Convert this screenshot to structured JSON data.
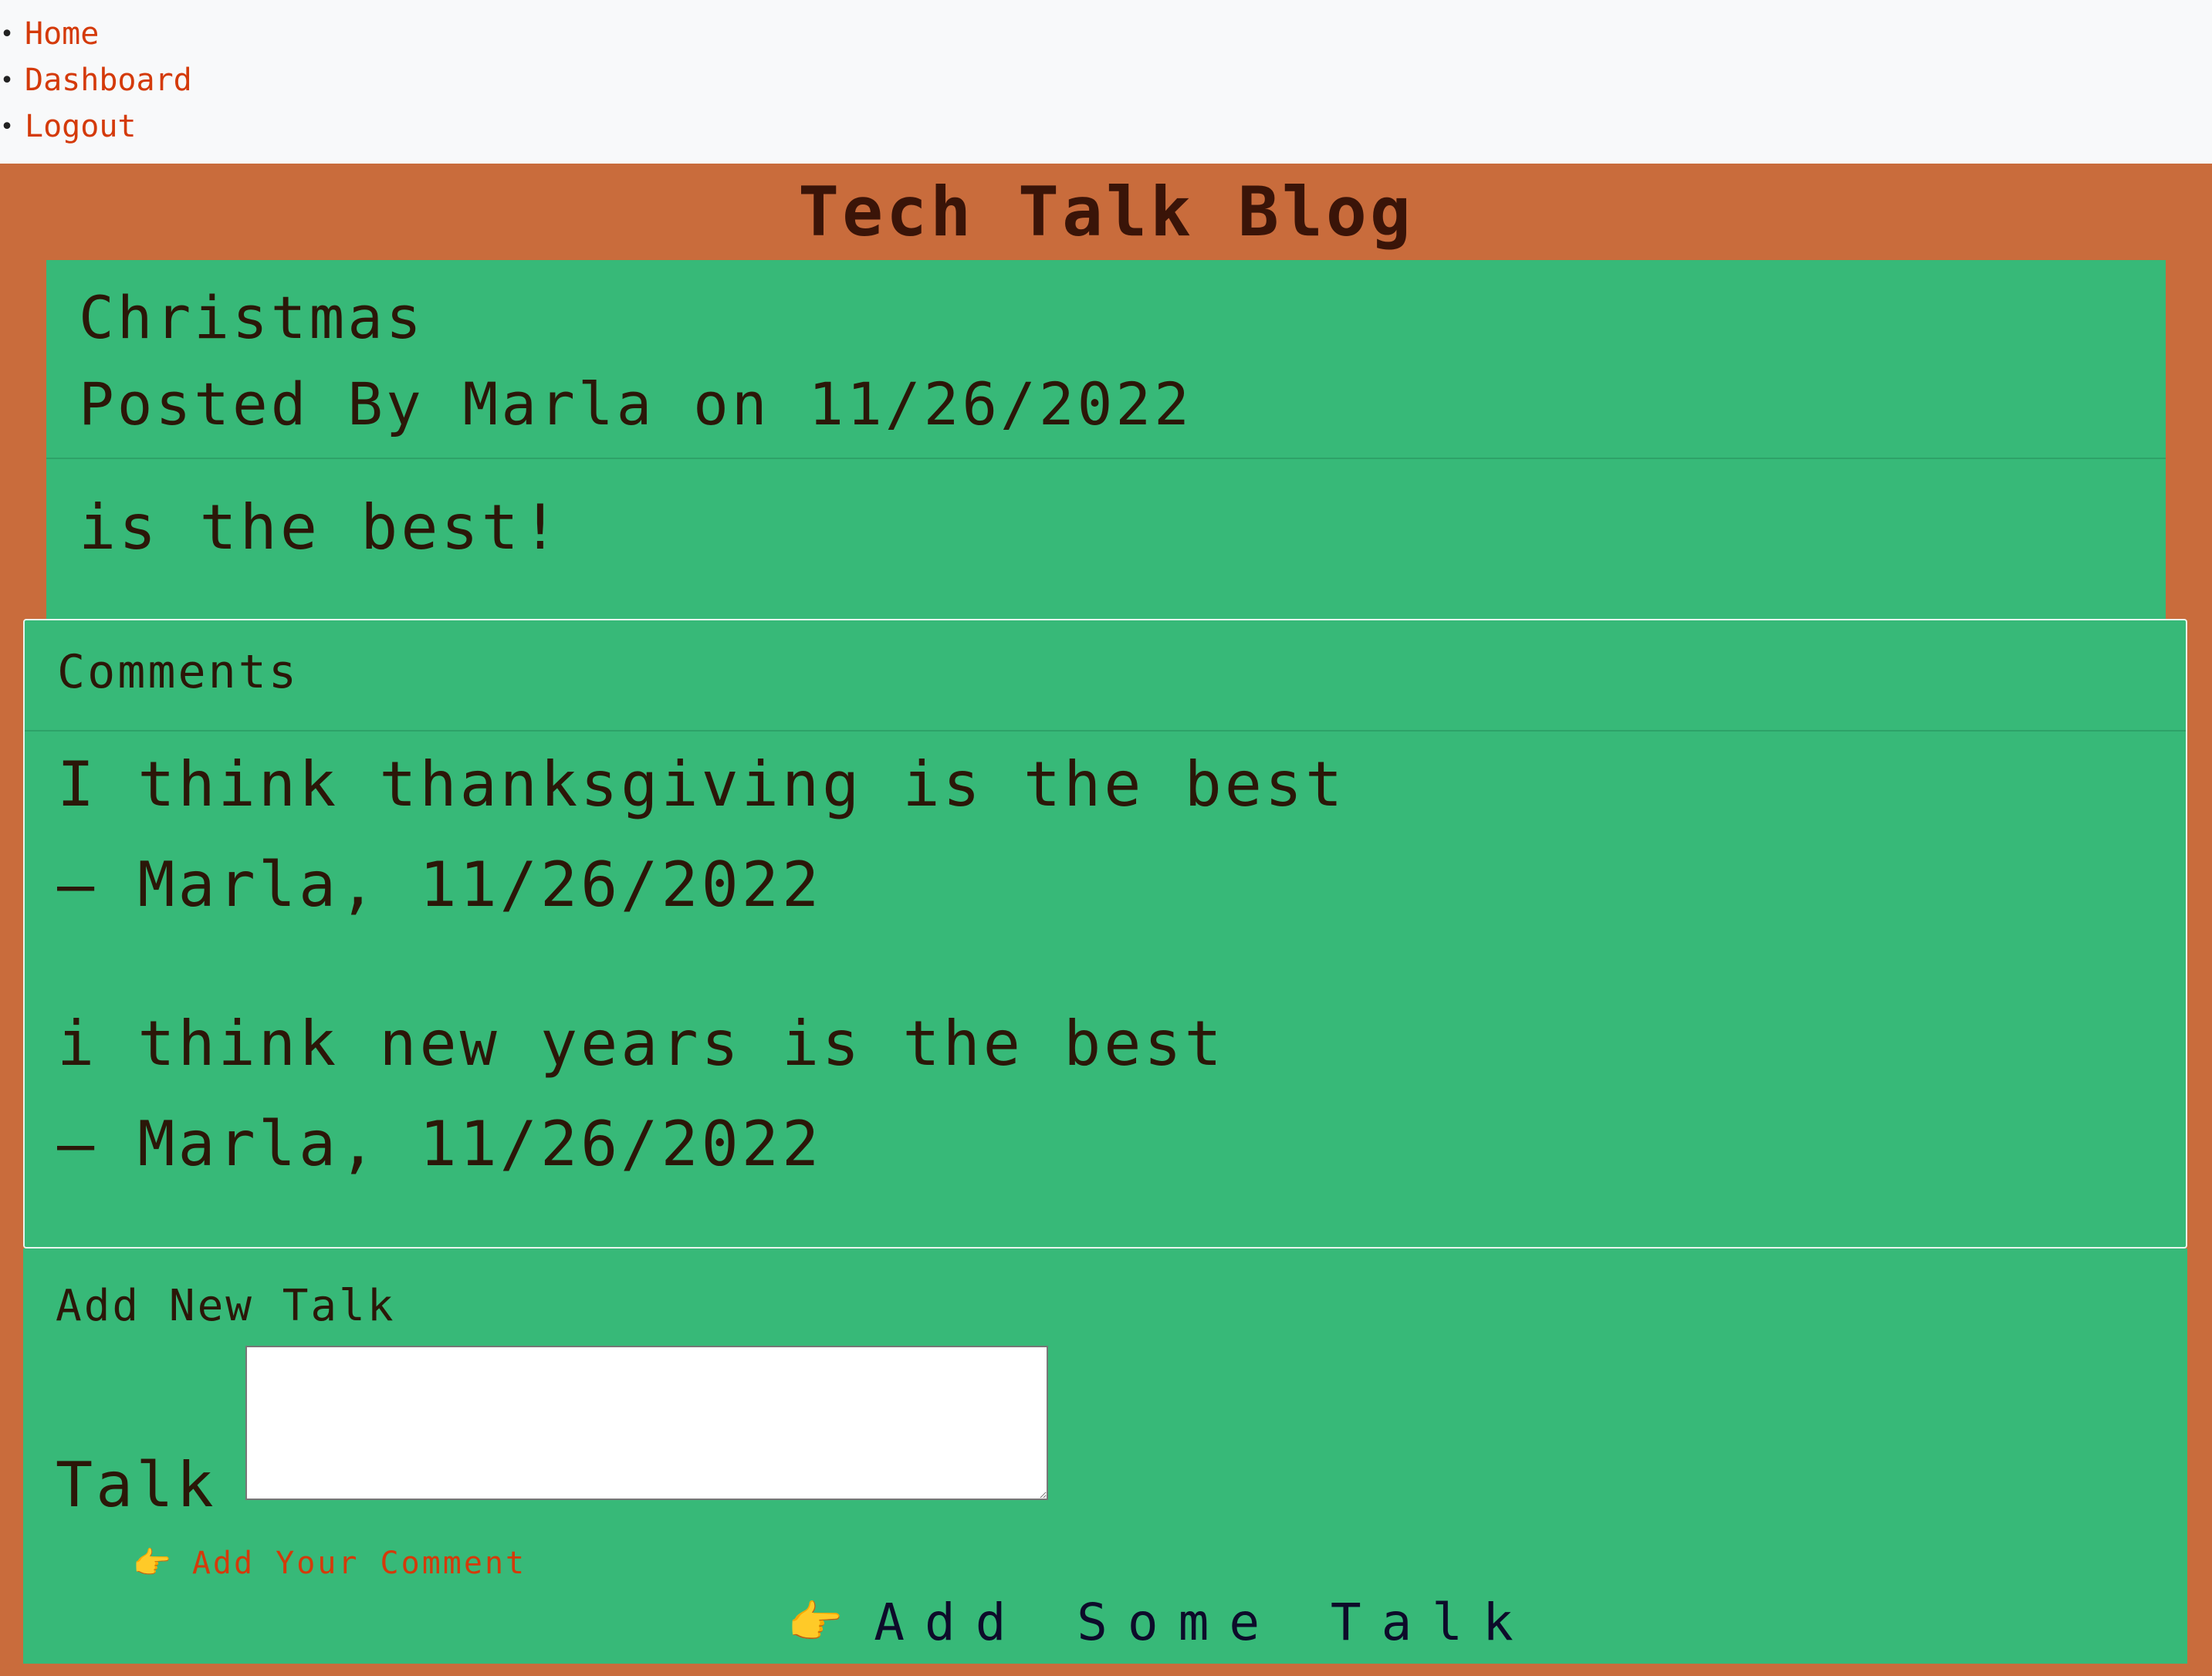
{
  "nav": {
    "items": [
      {
        "label": "Home"
      },
      {
        "label": "Dashboard"
      },
      {
        "label": "Logout"
      }
    ]
  },
  "site": {
    "title": "Tech Talk Blog"
  },
  "post": {
    "title": "Christmas",
    "meta": "Posted By Marla on 11/26/2022",
    "body": "is the best!"
  },
  "comments": {
    "title": "Comments",
    "items": [
      {
        "text": "I think thanksgiving is the best",
        "byline": "– Marla, 11/26/2022"
      },
      {
        "text": "i think new years is the best",
        "byline": "– Marla, 11/26/2022"
      }
    ]
  },
  "add_talk": {
    "title": "Add New Talk",
    "field_label": "Talk",
    "field_value": "",
    "link_icon": "pointing-finger-icon",
    "link_label": "Add Your Comment",
    "button_icon": "pointing-finger-icon",
    "button_label": "Add Some Talk"
  },
  "colors": {
    "page_bg": "#f8f9fa",
    "band": "#c96c3c",
    "card": "#37b978",
    "link": "#d43a0a",
    "text": "#2b1708"
  }
}
